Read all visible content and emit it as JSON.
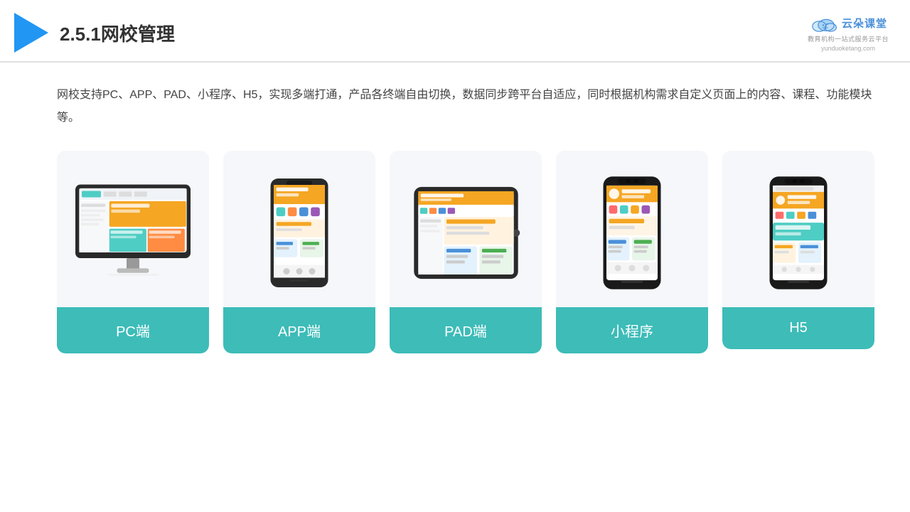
{
  "header": {
    "title": "2.5.1网校管理",
    "brand": {
      "name": "云朵课堂",
      "url": "yunduoketang.com",
      "sub": "教育机构一站式服务云平台"
    }
  },
  "description": "网校支持PC、APP、PAD、小程序、H5，实现多端打通，产品各终端自由切换，数据同步跨平台自适应，同时根据机构需求自定义页面上的内容、课程、功能模块等。",
  "cards": [
    {
      "label": "PC端",
      "type": "pc"
    },
    {
      "label": "APP端",
      "type": "phone"
    },
    {
      "label": "PAD端",
      "type": "tablet"
    },
    {
      "label": "小程序",
      "type": "phone"
    },
    {
      "label": "H5",
      "type": "phone"
    }
  ]
}
